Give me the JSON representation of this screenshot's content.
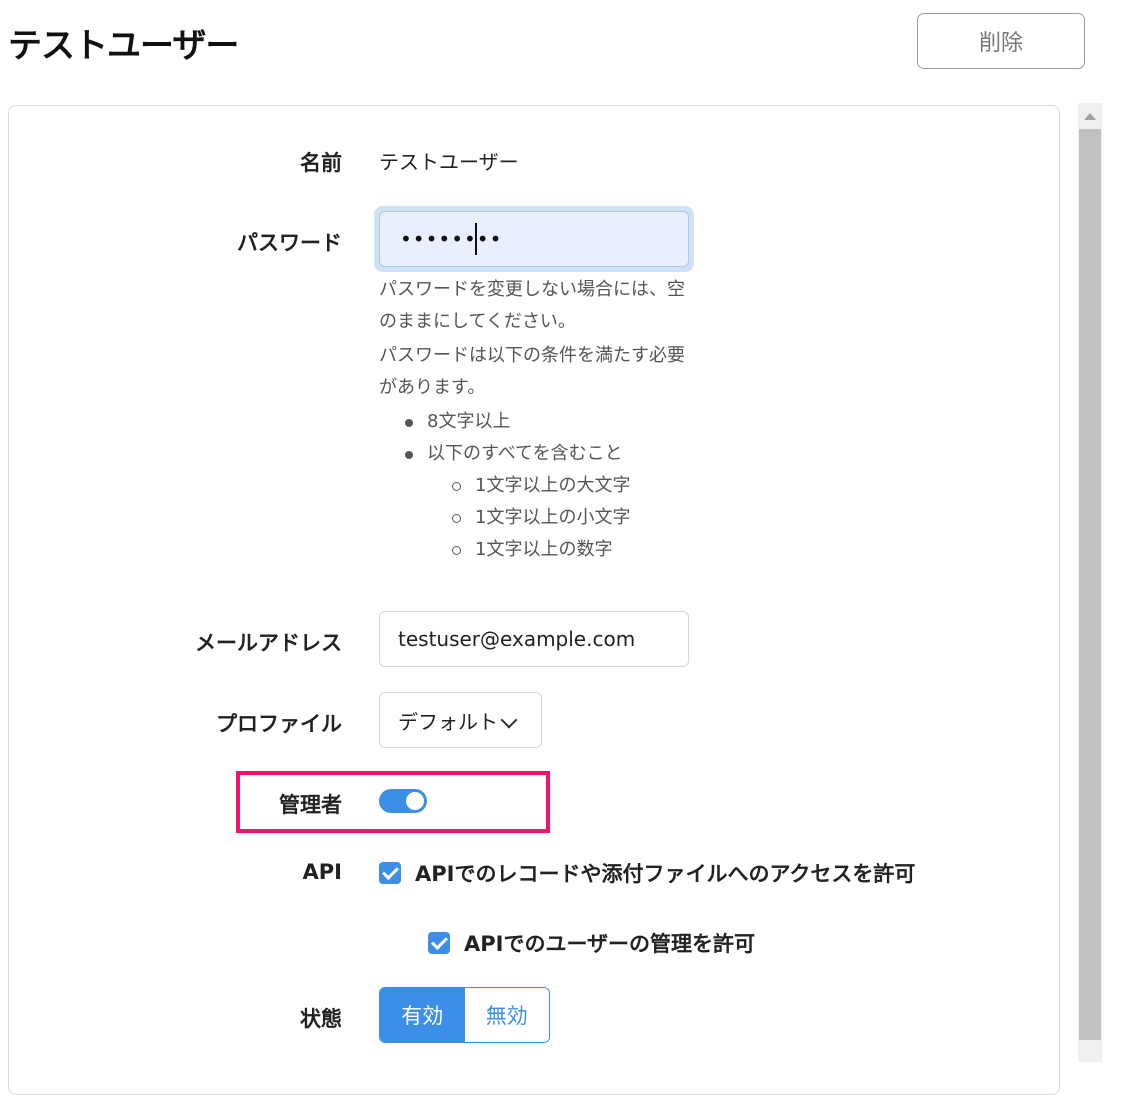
{
  "header": {
    "title": "テストユーザー",
    "delete_label": "削除"
  },
  "form": {
    "name": {
      "label": "名前",
      "value": "テストユーザー"
    },
    "password": {
      "label": "パスワード",
      "value": "••••••••",
      "help_intro": "パスワードを変更しない場合には、空のままにしてください。",
      "help_requirements": "パスワードは以下の条件を満たす必要があります。",
      "rules": [
        "8文字以上",
        "以下のすべてを含むこと"
      ],
      "sub_rules": [
        "1文字以上の大文字",
        "1文字以上の小文字",
        "1文字以上の数字"
      ]
    },
    "email": {
      "label": "メールアドレス",
      "value": "testuser@example.com"
    },
    "profile": {
      "label": "プロファイル",
      "selected": "デフォルト"
    },
    "admin": {
      "label": "管理者",
      "enabled": true
    },
    "api": {
      "label": "API",
      "allow_records": "APIでのレコードや添付ファイルへのアクセスを許可",
      "allow_records_checked": true,
      "allow_users": "APIでのユーザーの管理を許可",
      "allow_users_checked": true
    },
    "status": {
      "label": "状態",
      "options": [
        "有効",
        "無効"
      ],
      "selected": "有効"
    }
  },
  "colors": {
    "accent": "#3b8fe6",
    "highlight": "#f0146e",
    "password_bg": "#e8f0fe"
  }
}
